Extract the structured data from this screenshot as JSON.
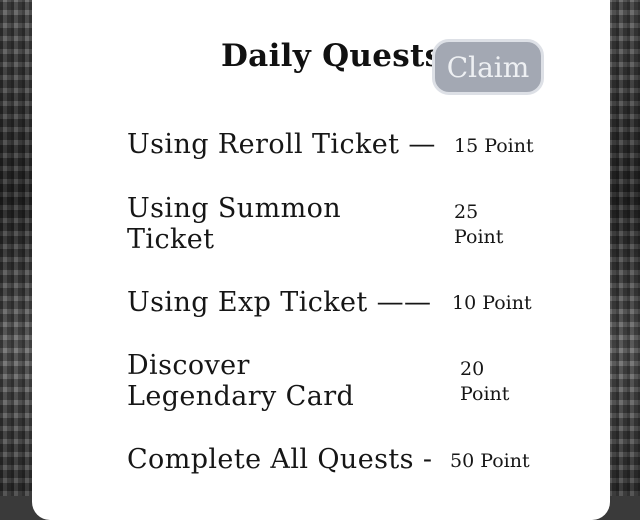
{
  "panel": {
    "title": "Daily Quests",
    "claim_label": "Claim"
  },
  "quests": [
    {
      "name": "Using Reroll Ticket  —",
      "points": "15 Point"
    },
    {
      "name": "Using Summon Ticket",
      "points": "25 Point"
    },
    {
      "name": "Using Exp Ticket  ——",
      "points": "10 Point"
    },
    {
      "name": "Discover Legendary Card",
      "points": "20 Point"
    },
    {
      "name": "Complete All Quests  -",
      "points": "50 Point"
    }
  ],
  "colors": {
    "panel_bg": "#ffffff",
    "claim_bg": "#a3a8b3",
    "claim_text": "#eef0f3",
    "text": "#161616"
  }
}
